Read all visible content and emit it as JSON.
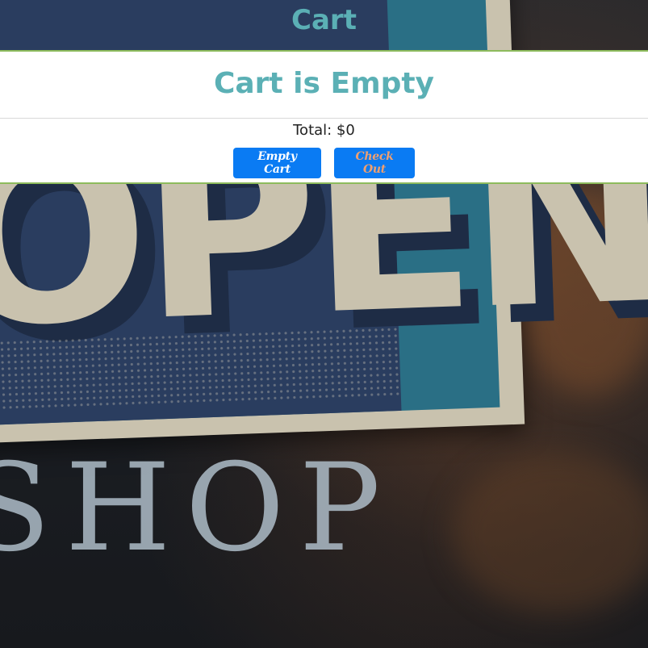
{
  "header": {
    "title": "Cart"
  },
  "cart": {
    "status_message": "Cart is Empty",
    "total_label": "Total: $0",
    "empty_cart_label": "Empty Cart",
    "checkout_label": "Check Out"
  },
  "background": {
    "sign_text": "OPEN",
    "shop_text": "SHOP"
  },
  "colors": {
    "accent_teal": "#5bb0b5",
    "button_blue": "#0a7bf3",
    "checkout_text": "#f0a070",
    "panel_border": "#8dbb5c"
  }
}
